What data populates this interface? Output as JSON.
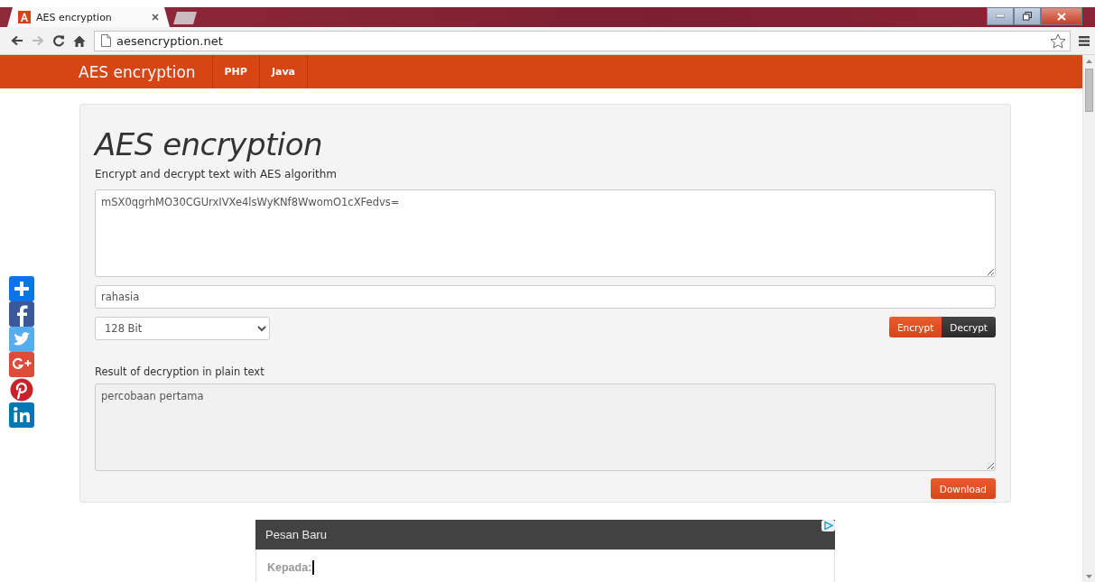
{
  "browser": {
    "tab": {
      "title": "AES encryption",
      "selected": true
    },
    "address": "aesencryption.net",
    "forward_disabled": true
  },
  "navbar": {
    "brand": "AES encryption",
    "links": [
      {
        "label": "PHP"
      },
      {
        "label": "Java"
      }
    ]
  },
  "card": {
    "heading": "AES encryption",
    "subtitle": "Encrypt and decrypt text with AES algorithm",
    "ciphertext": "mSX0qgrhMO30CGUrxIVXe4lsWyKNf8WwomO1cXFedvs=",
    "key": "rahasia",
    "key_size": "128 Bit",
    "buttons": [
      {
        "label": "Encrypt",
        "kind": "primary"
      },
      {
        "label": "Decrypt",
        "kind": "dark"
      }
    ],
    "result_label": "Result of decryption in plain text",
    "result": "percobaan pertama",
    "download": "Download"
  },
  "share": [
    {
      "kind": "add"
    },
    {
      "kind": "facebook"
    },
    {
      "kind": "twitter"
    },
    {
      "kind": "googleplus"
    },
    {
      "kind": "pinterest"
    },
    {
      "kind": "linkedin"
    }
  ],
  "ad": {
    "title": "Pesan Baru",
    "field_label": "Kepada:"
  }
}
